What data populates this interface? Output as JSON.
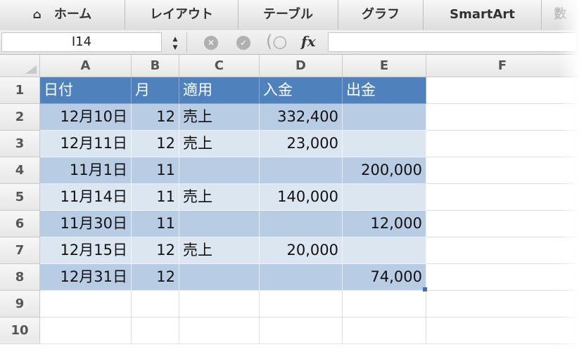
{
  "ribbon": {
    "tabs": [
      {
        "label": "ホーム",
        "icon": "home-icon"
      },
      {
        "label": "レイアウト"
      },
      {
        "label": "テーブル"
      },
      {
        "label": "グラフ"
      },
      {
        "label": "SmartArt"
      },
      {
        "label": "数"
      }
    ]
  },
  "formula_bar": {
    "name_box": "I14",
    "stepper": "▲▼",
    "cancel": "✕",
    "confirm": "✓",
    "fx": "fx",
    "formula": ""
  },
  "columns": [
    "A",
    "B",
    "C",
    "D",
    "E",
    "F"
  ],
  "rows": [
    "1",
    "2",
    "3",
    "4",
    "5",
    "6",
    "7",
    "8",
    "9",
    "10"
  ],
  "table": {
    "header": [
      "日付",
      "月",
      "適用",
      "入金",
      "出金"
    ],
    "body": [
      [
        "12月10日",
        "12",
        "売上",
        "332,400",
        ""
      ],
      [
        "12月11日",
        "12",
        "売上",
        "23,000",
        ""
      ],
      [
        "11月1日",
        "11",
        "",
        "",
        "200,000"
      ],
      [
        "11月14日",
        "11",
        "売上",
        "140,000",
        ""
      ],
      [
        "11月30日",
        "11",
        "",
        "",
        "12,000"
      ],
      [
        "12月15日",
        "12",
        "売上",
        "20,000",
        ""
      ],
      [
        "12月31日",
        "12",
        "",
        "",
        "74,000"
      ]
    ]
  },
  "colors": {
    "header_fill": "#4f81bd",
    "band_dark": "#b8cce4",
    "band_light": "#dce6f1"
  }
}
